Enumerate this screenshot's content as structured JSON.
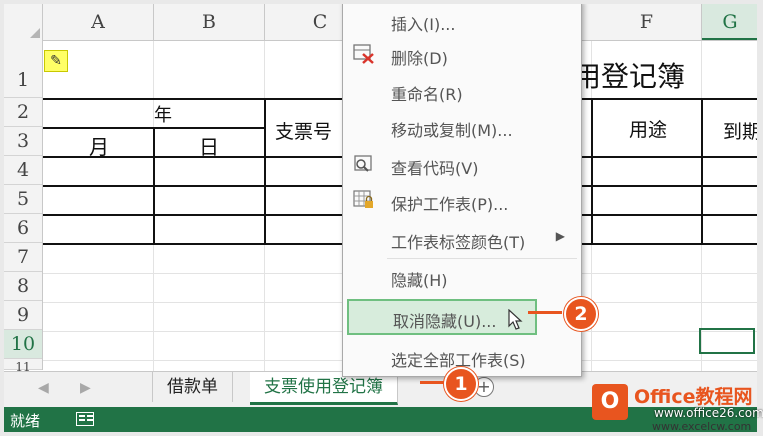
{
  "columns": [
    "A",
    "B",
    "C",
    "F",
    "G"
  ],
  "rows": [
    "1",
    "2",
    "3",
    "4",
    "5",
    "6",
    "7",
    "8",
    "9",
    "10",
    "11"
  ],
  "sheet": {
    "title_partial": "用登记簿",
    "year_label": "年",
    "month_label": "月",
    "day_label": "日",
    "cheque_no_partial": "支票号",
    "use_label": "用途",
    "due_partial": "到期"
  },
  "context_menu": {
    "items": [
      {
        "label": "插入(I)...",
        "icon": ""
      },
      {
        "label": "删除(D)",
        "icon": "delete-sheet-icon"
      },
      {
        "label": "重命名(R)",
        "icon": ""
      },
      {
        "label": "移动或复制(M)...",
        "icon": ""
      },
      {
        "label": "查看代码(V)",
        "icon": "view-code-icon"
      },
      {
        "label": "保护工作表(P)...",
        "icon": "protect-sheet-icon"
      },
      {
        "label": "工作表标签颜色(T)",
        "icon": "",
        "submenu": true
      },
      {
        "label": "隐藏(H)",
        "icon": ""
      },
      {
        "label": "取消隐藏(U)...",
        "icon": "",
        "highlighted": true
      },
      {
        "label": "选定全部工作表(S)",
        "icon": ""
      }
    ]
  },
  "tabs": [
    {
      "label": "借款单"
    },
    {
      "label": "支票使用登记簿",
      "active": true
    }
  ],
  "add_sheet": "+",
  "nav_prev": "◀",
  "nav_next": "▶",
  "status": {
    "text": "就绪"
  },
  "callouts": {
    "one": "1",
    "two": "2"
  },
  "watermark": {
    "logo": "O",
    "title": "Office教程网",
    "url1": "www.office26.com",
    "url2": "www.excelcw.com"
  },
  "colors": {
    "accent": "#217346",
    "callout": "#e8551f",
    "highlight": "#d7ecdc"
  }
}
